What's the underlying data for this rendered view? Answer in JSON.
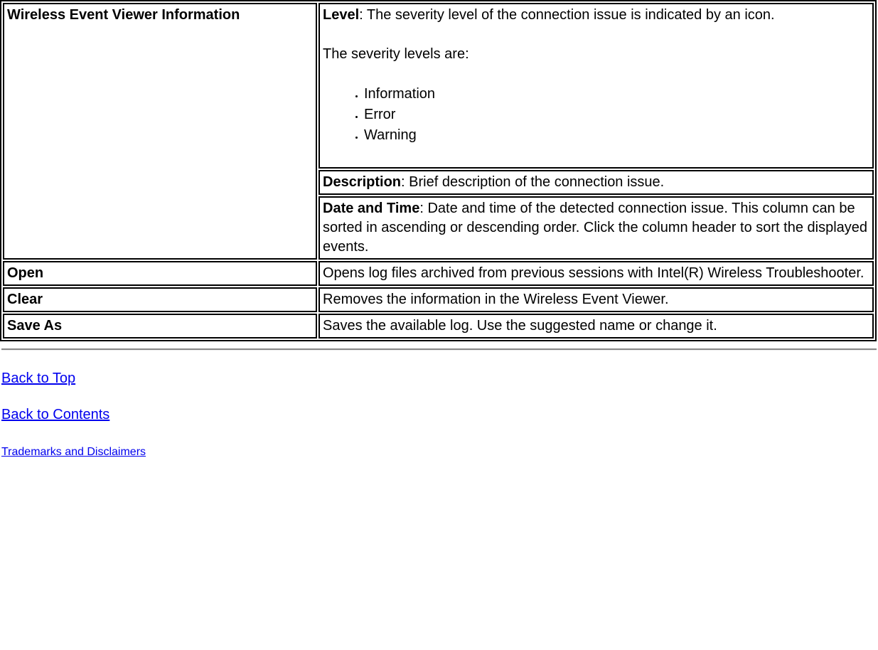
{
  "table": {
    "row0_header": "Wireless Event Viewer Information",
    "level": {
      "label": "Level",
      "text": ": The severity level of the connection issue is indicated by an icon.",
      "sub": "The severity levels are:",
      "items": [
        "Information",
        "Error",
        "Warning"
      ]
    },
    "description": {
      "label": "Description",
      "text": ": Brief description of the connection issue."
    },
    "datetime": {
      "label": "Date and Time",
      "text": ": Date and time of the detected connection issue. This column can be sorted in ascending or descending order. Click the column header to sort the displayed events."
    },
    "open": {
      "label": "Open",
      "text": "Opens log files archived from previous sessions with Intel(R) Wireless Troubleshooter."
    },
    "clear": {
      "label": "Clear",
      "text": "Removes the information in the Wireless Event Viewer."
    },
    "saveas": {
      "label": "Save As",
      "text": "Saves the available log. Use the suggested name or change it."
    }
  },
  "links": {
    "back_to_top": "Back to Top",
    "back_to_contents": "Back to Contents",
    "trademarks": "Trademarks and Disclaimers"
  }
}
